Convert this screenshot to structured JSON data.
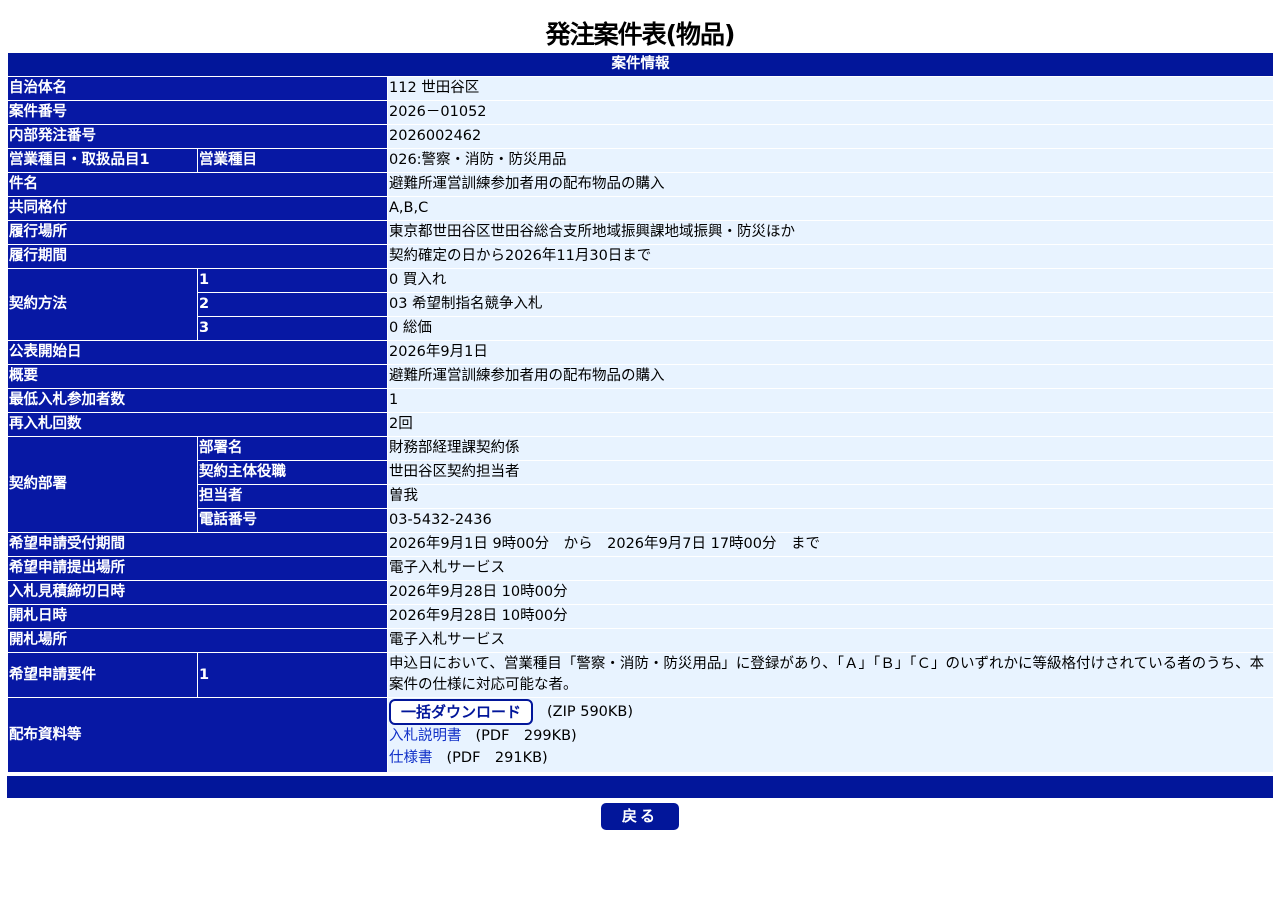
{
  "page": {
    "title": "発注案件表(物品)"
  },
  "section": {
    "title": "案件情報"
  },
  "rows": {
    "municipality": {
      "label": "自治体名",
      "value": "112 世田谷区"
    },
    "case_number": {
      "label": "案件番号",
      "value": "2026－01052"
    },
    "internal_order_number": {
      "label": "内部発注番号",
      "value": "2026002462"
    },
    "business_type": {
      "label": "営業種目・取扱品目1",
      "sublabel": "営業種目",
      "value": "026:警察・消防・防災用品"
    },
    "subject": {
      "label": "件名",
      "value": "避難所運営訓練参加者用の配布物品の購入"
    },
    "joint_rating": {
      "label": "共同格付",
      "value": "A,B,C"
    },
    "performance_place": {
      "label": "履行場所",
      "value": "東京都世田谷区世田谷総合支所地域振興課地域振興・防災ほか"
    },
    "performance_period": {
      "label": "履行期間",
      "value": "契約確定の日から2026年11月30日まで"
    },
    "contract_method": {
      "label": "契約方法",
      "items": [
        {
          "num": "1",
          "value": "0 買入れ"
        },
        {
          "num": "2",
          "value": "03 希望制指名競争入札"
        },
        {
          "num": "3",
          "value": "0 総価"
        }
      ]
    },
    "publication_start": {
      "label": "公表開始日",
      "value": "2026年9月1日"
    },
    "overview": {
      "label": "概要",
      "value": "避難所運営訓練参加者用の配布物品の購入"
    },
    "min_bidders": {
      "label": "最低入札参加者数",
      "value": "1"
    },
    "rebid_count": {
      "label": "再入札回数",
      "value": "2回"
    },
    "contract_department": {
      "label": "契約部署",
      "items": [
        {
          "sublabel": "部署名",
          "value": "財務部経理課契約係"
        },
        {
          "sublabel": "契約主体役職",
          "value": "世田谷区契約担当者"
        },
        {
          "sublabel": "担当者",
          "value": "曽我"
        },
        {
          "sublabel": "電話番号",
          "value": "03-5432-2436"
        }
      ]
    },
    "application_period": {
      "label": "希望申請受付期間",
      "value": "2026年9月1日 9時00分　から　2026年9月7日 17時00分　まで"
    },
    "application_place": {
      "label": "希望申請提出場所",
      "value": "電子入札サービス"
    },
    "bid_deadline": {
      "label": "入札見積締切日時",
      "value": "2026年9月28日 10時00分"
    },
    "opening_datetime": {
      "label": "開札日時",
      "value": "2026年9月28日 10時00分"
    },
    "opening_place": {
      "label": "開札場所",
      "value": "電子入札サービス"
    },
    "application_requirements": {
      "label": "希望申請要件",
      "num": "1",
      "value": "申込日において、営業種目「警察・消防・防災用品」に登録があり、「Ａ」「Ｂ」「Ｃ」のいずれかに等級格付けされている者のうち、本案件の仕様に対応可能な者。"
    },
    "distribution_materials": {
      "label": "配布資料等",
      "bulk_download_label": "一括ダウンロード",
      "bulk_download_meta": "(ZIP 590KB)",
      "docs": [
        {
          "name": "入札説明書",
          "meta": "(PDF　299KB)"
        },
        {
          "name": "仕様書",
          "meta": "(PDF　291KB)"
        }
      ]
    }
  },
  "footer": {
    "back_label": "戻る"
  }
}
